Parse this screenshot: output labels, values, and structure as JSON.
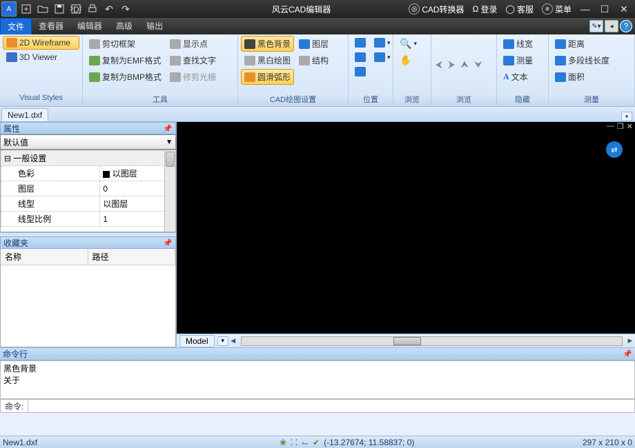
{
  "title": "风云CAD编辑器",
  "titlebar": {
    "right": [
      {
        "icon": "◎",
        "label": "CAD转换器"
      },
      {
        "icon": "☺",
        "label": "登录"
      },
      {
        "icon": "◑",
        "label": "客服"
      },
      {
        "icon": "≡",
        "label": "菜单"
      }
    ]
  },
  "menu": {
    "items": [
      "文件",
      "查看器",
      "编辑器",
      "高级",
      "输出"
    ],
    "active": 0
  },
  "ribbon": {
    "visual_styles": {
      "label": "Visual Styles",
      "items": [
        {
          "label": "2D Wireframe",
          "on": true
        },
        {
          "label": "3D Viewer",
          "on": false
        }
      ]
    },
    "tools": {
      "label": "工具",
      "items": [
        "剪切框架",
        "复制为EMF格式",
        "复制为BMP格式"
      ],
      "col2": [
        "显示点",
        "查找文字",
        "修剪光栅"
      ]
    },
    "cad_settings": {
      "label": "CAD绘图设置",
      "col1": [
        {
          "label": "黑色背景",
          "on": true
        },
        {
          "label": "黑白绘图"
        },
        {
          "label": "圆滑弧形",
          "on": true
        }
      ],
      "col2": [
        "图层",
        "结构"
      ]
    },
    "position": {
      "label": "位置"
    },
    "browse": {
      "label": "浏览"
    },
    "hide": {
      "label": "隐藏",
      "items": [
        "线宽",
        "测量",
        "文本"
      ]
    },
    "measure": {
      "label": "测量",
      "items": [
        "距离",
        "多段线长度",
        "面积"
      ]
    }
  },
  "filetab": "New1.dxf",
  "panels": {
    "props_title": "属性",
    "props_default": "默认值",
    "props_group": "一般设置",
    "props_rows": [
      {
        "k": "色彩",
        "v": "以图层",
        "swatch": true
      },
      {
        "k": "图层",
        "v": "0"
      },
      {
        "k": "线型",
        "v": "以图层"
      },
      {
        "k": "线型比例",
        "v": "1"
      }
    ],
    "fav_title": "收藏夹",
    "fav_cols": [
      "名称",
      "路径"
    ]
  },
  "viewport": {
    "modeltab": "Model"
  },
  "cmd": {
    "title": "命令行",
    "history": [
      "黑色背景",
      "关于"
    ],
    "prompt": "命令:"
  },
  "status": {
    "file": "New1.dxf",
    "coords": "(-13.27674; 11.58837; 0)",
    "dims": "297 x 210 x 0"
  }
}
